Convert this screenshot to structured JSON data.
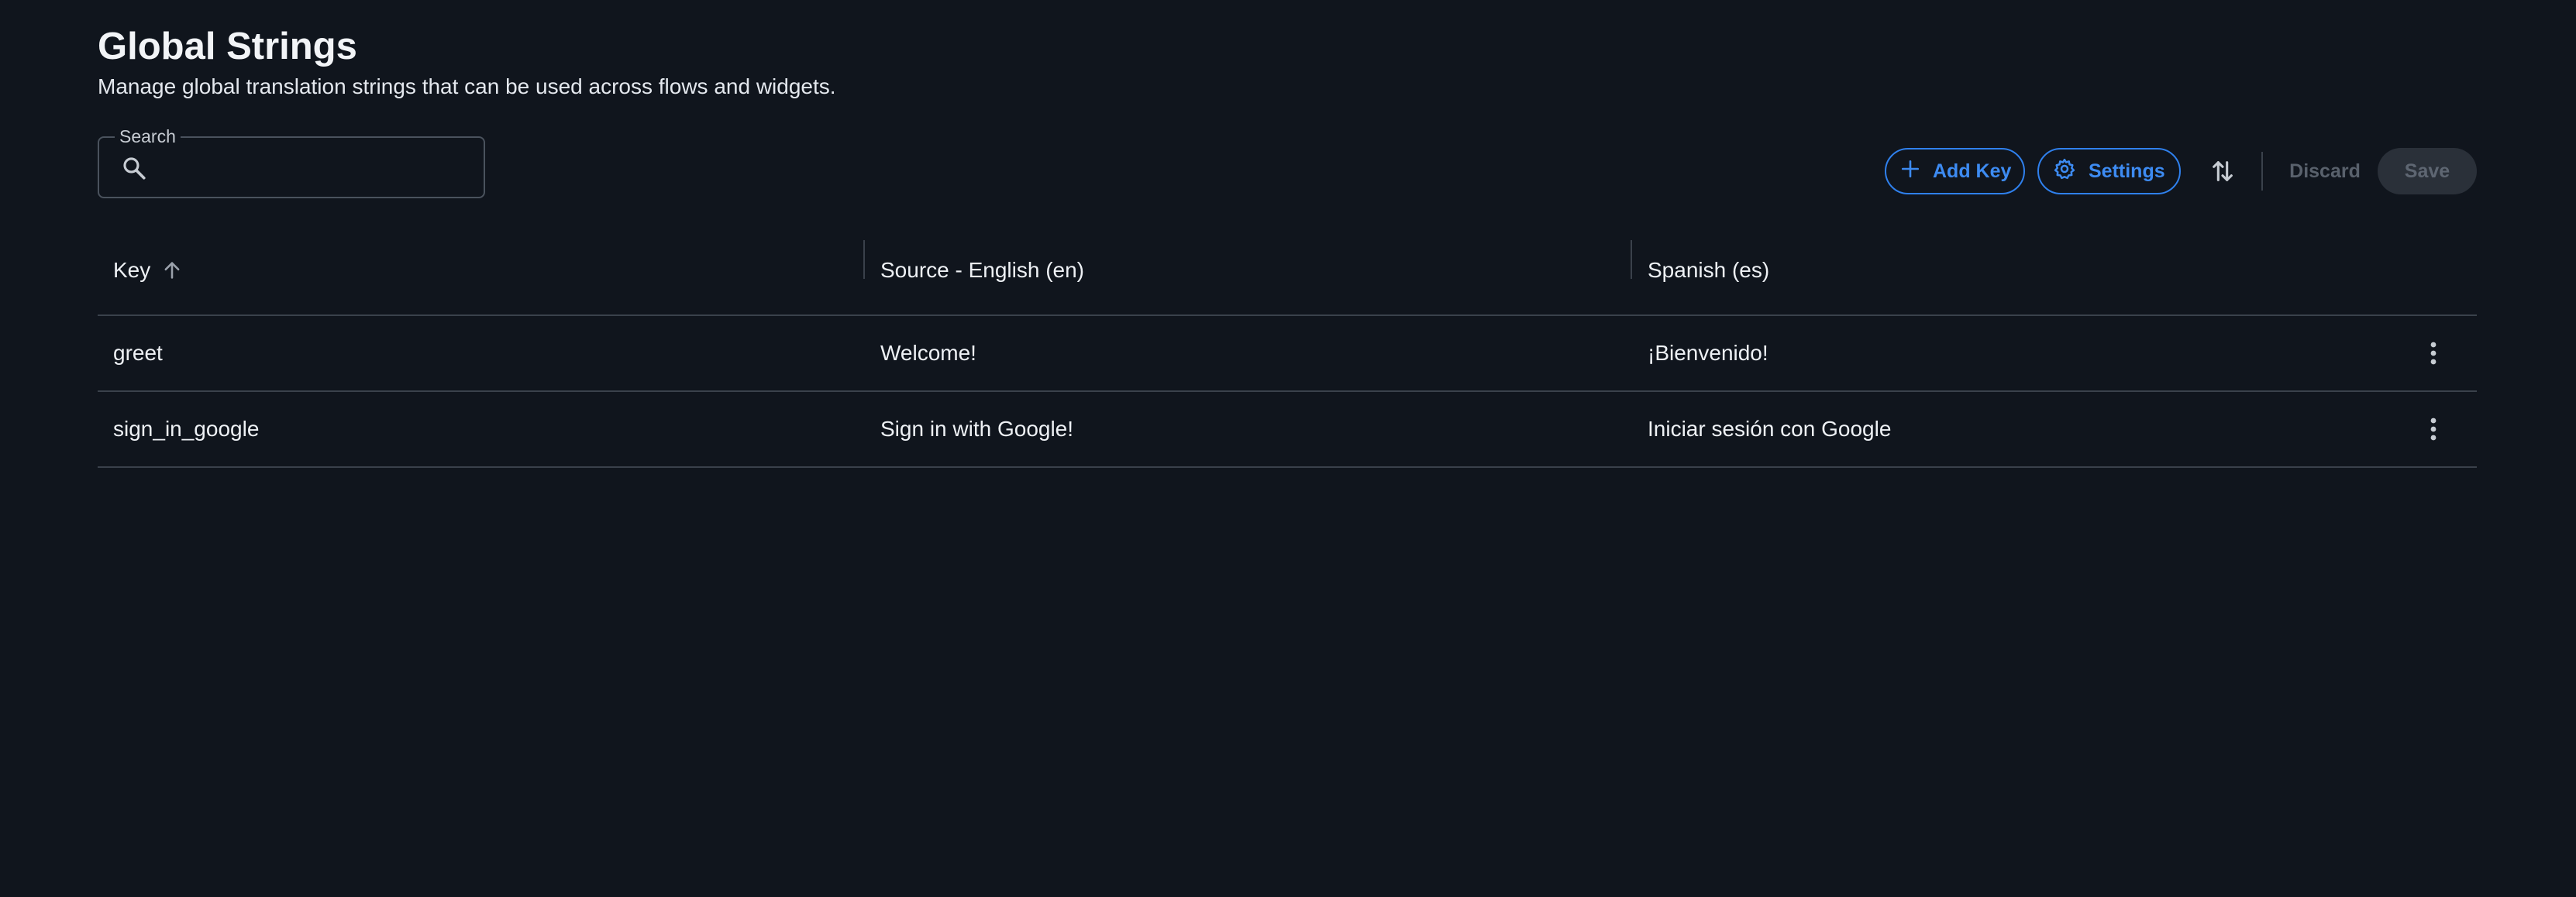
{
  "header": {
    "title": "Global Strings",
    "subtitle": "Manage global translation strings that can be used across flows and widgets."
  },
  "search": {
    "label": "Search",
    "value": "",
    "placeholder": ""
  },
  "toolbar": {
    "add_key_label": "Add Key",
    "settings_label": "Settings",
    "discard_label": "Discard",
    "save_label": "Save"
  },
  "table": {
    "columns": [
      "Key",
      "Source - English (en)",
      "Spanish (es)"
    ],
    "sort": {
      "column": "Key",
      "direction": "ascending"
    },
    "rows": [
      {
        "key": "greet",
        "source": "Welcome!",
        "spanish": "¡Bienvenido!"
      },
      {
        "key": "sign_in_google",
        "source": "Sign in with Google!",
        "spanish": "Iniciar sesión con Google"
      }
    ]
  },
  "colors": {
    "background": "#10151d",
    "accent": "#2f80ed",
    "divider": "#3a414b",
    "disabled_text": "#59616c"
  },
  "icons": [
    "search-icon",
    "plus-icon",
    "gear-icon",
    "sort-arrows-icon",
    "arrow-up-icon",
    "more-vertical-icon"
  ]
}
